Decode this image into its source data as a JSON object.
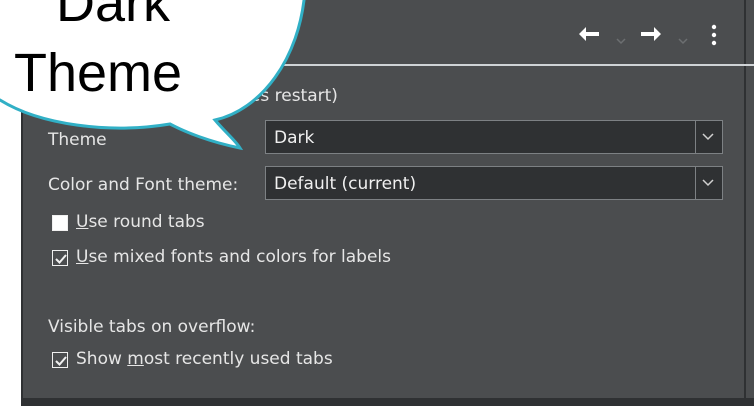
{
  "toolbar": {
    "back_icon": "back-arrow-icon",
    "forward_icon": "forward-arrow-icon",
    "more_icon": "more-vertical-icon"
  },
  "callout": {
    "line1": "Dark",
    "line2": "Theme"
  },
  "header_note": "quires restart)",
  "theme": {
    "label": "Theme",
    "value": "Dark"
  },
  "color_font_theme": {
    "label": "Color and Font theme:",
    "value": "Default (current)"
  },
  "checkboxes": {
    "round_tabs": {
      "label_u": "U",
      "label_rest": "se round tabs",
      "checked": false
    },
    "mixed_fonts": {
      "label_u": "U",
      "label_rest": "se mixed fonts and colors for labels",
      "checked": true
    }
  },
  "overflow": {
    "section_label": "Visible tabs on overflow:",
    "mru": {
      "label_pre": "Show ",
      "label_u": "m",
      "label_rest": "ost recently used tabs",
      "checked": true
    }
  }
}
